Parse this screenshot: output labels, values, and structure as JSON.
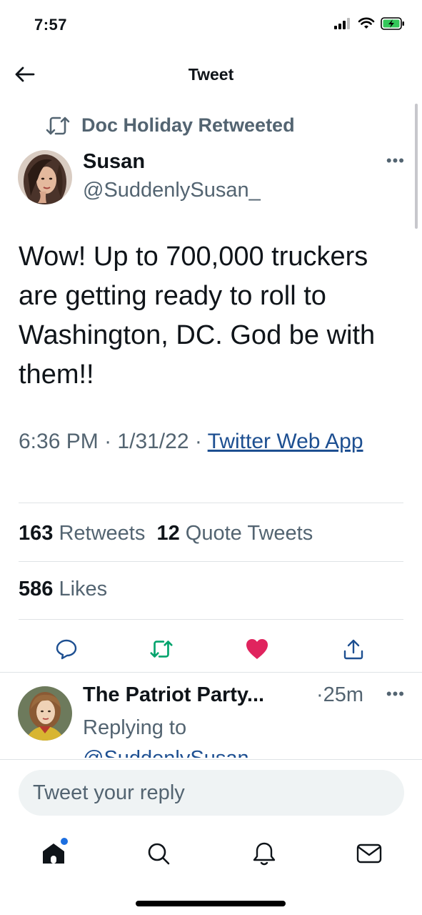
{
  "status": {
    "time": "7:57"
  },
  "header": {
    "title": "Tweet"
  },
  "retweet_context": {
    "label": "Doc Holiday Retweeted"
  },
  "tweet": {
    "author_name": "Susan",
    "author_handle": "@SuddenlySusan_",
    "text": "Wow! Up to 700,000 truckers are getting ready to roll to Washington, DC. God be with them!!",
    "time": "6:36 PM",
    "separator": "·",
    "date": "1/31/22",
    "source": "Twitter Web App",
    "retweets_count": "163",
    "retweets_label": "Retweets",
    "quotes_count": "12",
    "quotes_label": "Quote Tweets",
    "likes_count": "586",
    "likes_label": "Likes",
    "liked": true
  },
  "reply": {
    "author_name": "The Patriot Party...",
    "time": "·25m",
    "replying_to_label": "Replying to",
    "replying_to_handle": "@SuddenlySusan_"
  },
  "compose": {
    "placeholder": "Tweet your reply"
  },
  "colors": {
    "accent": "#1d9bf0",
    "like": "#e0245e",
    "retweet": "#00ba7c",
    "muted": "#536471"
  },
  "icons": [
    "back-arrow-icon",
    "retweet-icon",
    "more-icon",
    "reply-icon",
    "heart-icon",
    "share-icon",
    "home-icon",
    "search-icon",
    "bell-icon",
    "mail-icon"
  ]
}
